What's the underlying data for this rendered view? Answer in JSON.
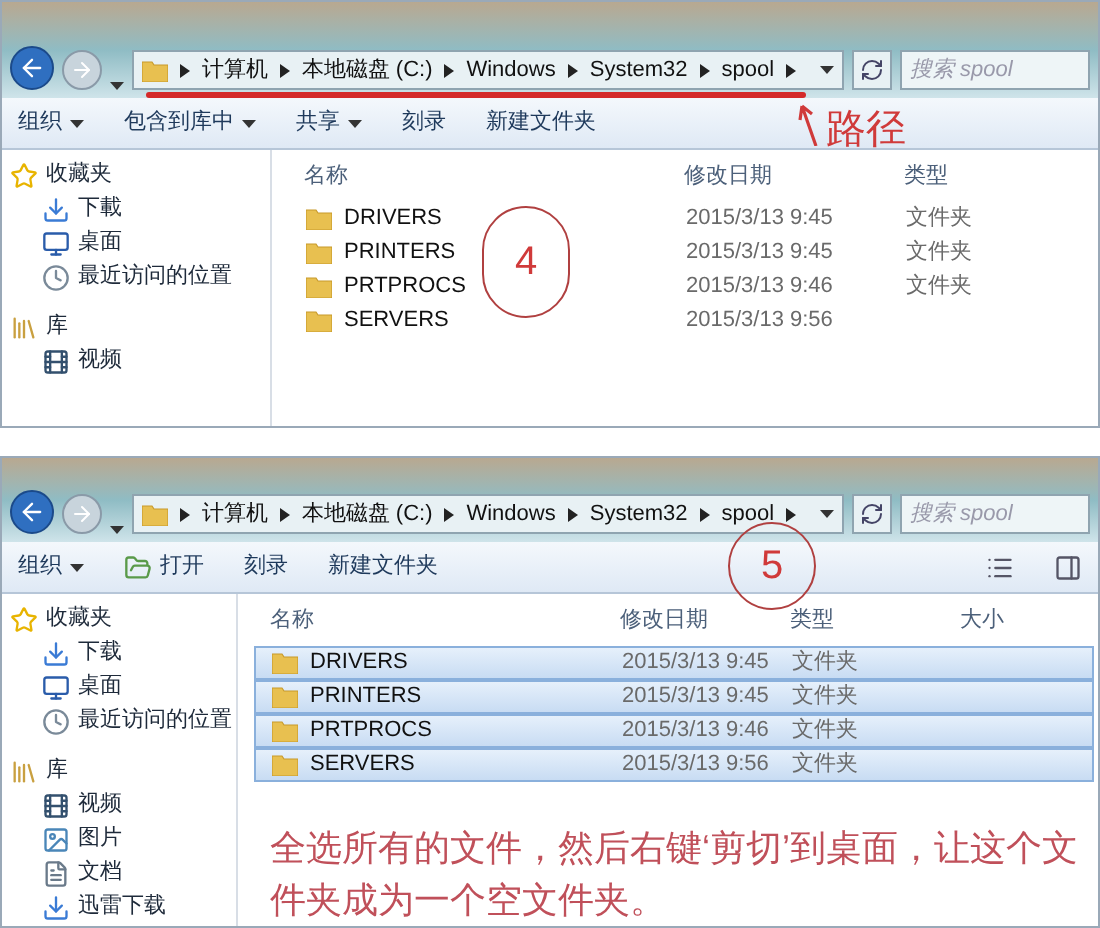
{
  "panels": [
    {
      "address": {
        "segments": [
          "计算机",
          "本地磁盘 (C:)",
          "Windows",
          "System32",
          "spool"
        ]
      },
      "search": {
        "placeholder": "搜索 spool"
      },
      "toolbar": [
        {
          "label": "组织",
          "dropdown": true,
          "kind": "text"
        },
        {
          "label": "包含到库中",
          "dropdown": true,
          "kind": "text"
        },
        {
          "label": "共享",
          "dropdown": true,
          "kind": "text"
        },
        {
          "label": "刻录",
          "dropdown": false,
          "kind": "text"
        },
        {
          "label": "新建文件夹",
          "dropdown": false,
          "kind": "text"
        }
      ],
      "view_controls": false,
      "sidebar": [
        {
          "label": "收藏夹",
          "kind": "star",
          "children": [
            {
              "label": "下載",
              "kind": "download"
            },
            {
              "label": "桌面",
              "kind": "desktop"
            },
            {
              "label": "最近访问的位置",
              "kind": "recent"
            }
          ]
        },
        {
          "label": "库",
          "kind": "library",
          "children": [
            {
              "label": "视频",
              "kind": "video"
            }
          ]
        }
      ],
      "columns": [
        "名称",
        "修改日期",
        "类型"
      ],
      "rows": [
        {
          "name": "DRIVERS",
          "modified": "2015/3/13 9:45",
          "type": "文件夹",
          "selected": false
        },
        {
          "name": "PRINTERS",
          "modified": "2015/3/13 9:45",
          "type": "文件夹",
          "selected": false
        },
        {
          "name": "PRTPROCS",
          "modified": "2015/3/13 9:46",
          "type": "文件夹",
          "selected": false
        },
        {
          "name": "SERVERS",
          "modified": "2015/3/13 9:56",
          "selected": false
        }
      ],
      "step": "4",
      "path_label": "路径"
    },
    {
      "address": {
        "segments": [
          "计算机",
          "本地磁盘 (C:)",
          "Windows",
          "System32",
          "spool"
        ]
      },
      "search": {
        "placeholder": "搜索 spool"
      },
      "toolbar": [
        {
          "label": "组织",
          "dropdown": true,
          "kind": "text"
        },
        {
          "label": "打开",
          "dropdown": false,
          "kind": "open"
        },
        {
          "label": "刻录",
          "dropdown": false,
          "kind": "text"
        },
        {
          "label": "新建文件夹",
          "dropdown": false,
          "kind": "text"
        }
      ],
      "view_controls": true,
      "sidebar": [
        {
          "label": "收藏夹",
          "kind": "star",
          "children": [
            {
              "label": "下载",
              "kind": "download"
            },
            {
              "label": "桌面",
              "kind": "desktop"
            },
            {
              "label": "最近访问的位置",
              "kind": "recent"
            }
          ]
        },
        {
          "label": "库",
          "kind": "library",
          "children": [
            {
              "label": "视频",
              "kind": "video"
            },
            {
              "label": "图片",
              "kind": "picture"
            },
            {
              "label": "文档",
              "kind": "document"
            },
            {
              "label": "迅雷下载",
              "kind": "download"
            }
          ]
        }
      ],
      "columns": [
        "名称",
        "修改日期",
        "类型",
        "大小"
      ],
      "rows": [
        {
          "name": "DRIVERS",
          "modified": "2015/3/13 9:45",
          "type": "文件夹",
          "selected": true
        },
        {
          "name": "PRINTERS",
          "modified": "2015/3/13 9:45",
          "type": "文件夹",
          "selected": true
        },
        {
          "name": "PRTPROCS",
          "modified": "2015/3/13 9:46",
          "type": "文件夹",
          "selected": true
        },
        {
          "name": "SERVERS",
          "modified": "2015/3/13 9:56",
          "type": "文件夹",
          "selected": true
        }
      ],
      "step": "5",
      "note": "全选所有的文件，然后右键‘剪切’到桌面，让这个文件夹成为一个空文件夹。"
    }
  ]
}
